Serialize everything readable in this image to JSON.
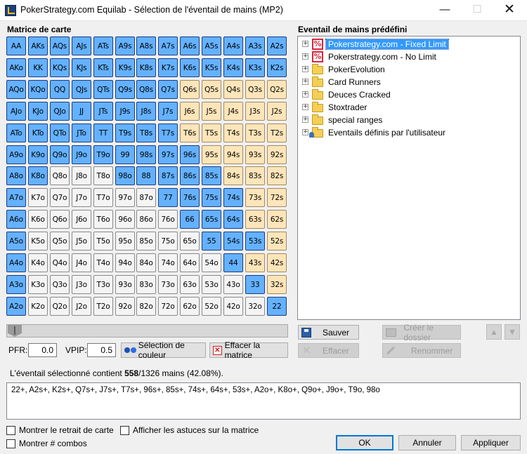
{
  "window": {
    "title": "PokerStrategy.com Equilab - Sélection de l'éventail de mains (MP2)",
    "min_glyph": "—",
    "max_glyph": "☐",
    "close_glyph": "✕"
  },
  "matrix": {
    "label": "Matrice de carte",
    "rows": [
      [
        [
          "AA",
          "s"
        ],
        [
          "AKs",
          "s"
        ],
        [
          "AQs",
          "s"
        ],
        [
          "AJs",
          "s"
        ],
        [
          "ATs",
          "s"
        ],
        [
          "A9s",
          "s"
        ],
        [
          "A8s",
          "s"
        ],
        [
          "A7s",
          "s"
        ],
        [
          "A6s",
          "s"
        ],
        [
          "A5s",
          "s"
        ],
        [
          "A4s",
          "s"
        ],
        [
          "A3s",
          "s"
        ],
        [
          "A2s",
          "s"
        ]
      ],
      [
        [
          "AKo",
          "s"
        ],
        [
          "KK",
          "s"
        ],
        [
          "KQs",
          "s"
        ],
        [
          "KJs",
          "s"
        ],
        [
          "KTs",
          "s"
        ],
        [
          "K9s",
          "s"
        ],
        [
          "K8s",
          "s"
        ],
        [
          "K7s",
          "s"
        ],
        [
          "K6s",
          "s"
        ],
        [
          "K5s",
          "s"
        ],
        [
          "K4s",
          "s"
        ],
        [
          "K3s",
          "s"
        ],
        [
          "K2s",
          "s"
        ]
      ],
      [
        [
          "AQo",
          "s"
        ],
        [
          "KQo",
          "s"
        ],
        [
          "QQ",
          "s"
        ],
        [
          "QJs",
          "s"
        ],
        [
          "QTs",
          "s"
        ],
        [
          "Q9s",
          "s"
        ],
        [
          "Q8s",
          "s"
        ],
        [
          "Q7s",
          "s"
        ],
        [
          "Q6s",
          "u"
        ],
        [
          "Q5s",
          "u"
        ],
        [
          "Q4s",
          "u"
        ],
        [
          "Q3s",
          "u"
        ],
        [
          "Q2s",
          "u"
        ]
      ],
      [
        [
          "AJo",
          "s"
        ],
        [
          "KJo",
          "s"
        ],
        [
          "QJo",
          "s"
        ],
        [
          "JJ",
          "s"
        ],
        [
          "JTs",
          "s"
        ],
        [
          "J9s",
          "s"
        ],
        [
          "J8s",
          "s"
        ],
        [
          "J7s",
          "s"
        ],
        [
          "J6s",
          "u"
        ],
        [
          "J5s",
          "u"
        ],
        [
          "J4s",
          "u"
        ],
        [
          "J3s",
          "u"
        ],
        [
          "J2s",
          "u"
        ]
      ],
      [
        [
          "ATo",
          "s"
        ],
        [
          "KTo",
          "s"
        ],
        [
          "QTo",
          "s"
        ],
        [
          "JTo",
          "s"
        ],
        [
          "TT",
          "s"
        ],
        [
          "T9s",
          "s"
        ],
        [
          "T8s",
          "s"
        ],
        [
          "T7s",
          "s"
        ],
        [
          "T6s",
          "u"
        ],
        [
          "T5s",
          "u"
        ],
        [
          "T4s",
          "u"
        ],
        [
          "T3s",
          "u"
        ],
        [
          "T2s",
          "u"
        ]
      ],
      [
        [
          "A9o",
          "s"
        ],
        [
          "K9o",
          "s"
        ],
        [
          "Q9o",
          "s"
        ],
        [
          "J9o",
          "s"
        ],
        [
          "T9o",
          "s"
        ],
        [
          "99",
          "s"
        ],
        [
          "98s",
          "s"
        ],
        [
          "97s",
          "s"
        ],
        [
          "96s",
          "s"
        ],
        [
          "95s",
          "u"
        ],
        [
          "94s",
          "u"
        ],
        [
          "93s",
          "u"
        ],
        [
          "92s",
          "u"
        ]
      ],
      [
        [
          "A8o",
          "s"
        ],
        [
          "K8o",
          "s"
        ],
        [
          "Q8o",
          "o"
        ],
        [
          "J8o",
          "o"
        ],
        [
          "T8o",
          "o"
        ],
        [
          "98o",
          "s"
        ],
        [
          "88",
          "s"
        ],
        [
          "87s",
          "s"
        ],
        [
          "86s",
          "s"
        ],
        [
          "85s",
          "s"
        ],
        [
          "84s",
          "u"
        ],
        [
          "83s",
          "u"
        ],
        [
          "82s",
          "u"
        ]
      ],
      [
        [
          "A7o",
          "s"
        ],
        [
          "K7o",
          "o"
        ],
        [
          "Q7o",
          "o"
        ],
        [
          "J7o",
          "o"
        ],
        [
          "T7o",
          "o"
        ],
        [
          "97o",
          "o"
        ],
        [
          "87o",
          "o"
        ],
        [
          "77",
          "s"
        ],
        [
          "76s",
          "s"
        ],
        [
          "75s",
          "s"
        ],
        [
          "74s",
          "s"
        ],
        [
          "73s",
          "u"
        ],
        [
          "72s",
          "u"
        ]
      ],
      [
        [
          "A6o",
          "s"
        ],
        [
          "K6o",
          "o"
        ],
        [
          "Q6o",
          "o"
        ],
        [
          "J6o",
          "o"
        ],
        [
          "T6o",
          "o"
        ],
        [
          "96o",
          "o"
        ],
        [
          "86o",
          "o"
        ],
        [
          "76o",
          "o"
        ],
        [
          "66",
          "s"
        ],
        [
          "65s",
          "s"
        ],
        [
          "64s",
          "s"
        ],
        [
          "63s",
          "u"
        ],
        [
          "62s",
          "u"
        ]
      ],
      [
        [
          "A5o",
          "s"
        ],
        [
          "K5o",
          "o"
        ],
        [
          "Q5o",
          "o"
        ],
        [
          "J5o",
          "o"
        ],
        [
          "T5o",
          "o"
        ],
        [
          "95o",
          "o"
        ],
        [
          "85o",
          "o"
        ],
        [
          "75o",
          "o"
        ],
        [
          "65o",
          "o"
        ],
        [
          "55",
          "s"
        ],
        [
          "54s",
          "s"
        ],
        [
          "53s",
          "s"
        ],
        [
          "52s",
          "u"
        ]
      ],
      [
        [
          "A4o",
          "s"
        ],
        [
          "K4o",
          "o"
        ],
        [
          "Q4o",
          "o"
        ],
        [
          "J4o",
          "o"
        ],
        [
          "T4o",
          "o"
        ],
        [
          "94o",
          "o"
        ],
        [
          "84o",
          "o"
        ],
        [
          "74o",
          "o"
        ],
        [
          "64o",
          "o"
        ],
        [
          "54o",
          "o"
        ],
        [
          "44",
          "s"
        ],
        [
          "43s",
          "u"
        ],
        [
          "42s",
          "u"
        ]
      ],
      [
        [
          "A3o",
          "s"
        ],
        [
          "K3o",
          "o"
        ],
        [
          "Q3o",
          "o"
        ],
        [
          "J3o",
          "o"
        ],
        [
          "T3o",
          "o"
        ],
        [
          "93o",
          "o"
        ],
        [
          "83o",
          "o"
        ],
        [
          "73o",
          "o"
        ],
        [
          "63o",
          "o"
        ],
        [
          "53o",
          "o"
        ],
        [
          "43o",
          "o"
        ],
        [
          "33",
          "s"
        ],
        [
          "32s",
          "u"
        ]
      ],
      [
        [
          "A2o",
          "s"
        ],
        [
          "K2o",
          "o"
        ],
        [
          "Q2o",
          "o"
        ],
        [
          "J2o",
          "o"
        ],
        [
          "T2o",
          "o"
        ],
        [
          "92o",
          "o"
        ],
        [
          "82o",
          "o"
        ],
        [
          "72o",
          "o"
        ],
        [
          "62o",
          "o"
        ],
        [
          "52o",
          "o"
        ],
        [
          "42o",
          "o"
        ],
        [
          "32o",
          "o"
        ],
        [
          "22",
          "s"
        ]
      ]
    ]
  },
  "controls": {
    "pfr_label": "PFR:",
    "pfr_value": "0.0",
    "vpip_label": "VPIP:",
    "vpip_value": "0.5",
    "color_button": "Sélection de couleur",
    "clear_button": "Effacer la matrice"
  },
  "predefined": {
    "label": "Eventail de mains prédéfini",
    "items": [
      {
        "label": "Pokerstrategy.com - Fixed Limit",
        "icon": "pokerstrategy-icon"
      },
      {
        "label": "Pokerstrategy.com - No Limit",
        "icon": "pokerstrategy-icon"
      },
      {
        "label": "PokerEvolution",
        "icon": "folder-icon"
      },
      {
        "label": "Card Runners",
        "icon": "folder-icon"
      },
      {
        "label": "Deuces Cracked",
        "icon": "folder-icon"
      },
      {
        "label": "Stoxtrader",
        "icon": "folder-icon"
      },
      {
        "label": "special ranges",
        "icon": "folder-icon"
      },
      {
        "label": "Eventails définis par l'utilisateur",
        "icon": "user-folder-icon"
      }
    ],
    "expander_glyph": "+",
    "save": "Sauver",
    "delete": "Effacer",
    "create_folder": "Créer le dossier",
    "rename": "Renommer",
    "up_glyph": "▲",
    "down_glyph": "▼"
  },
  "summary": {
    "prefix": "L'éventail sélectionné contient ",
    "count": "558",
    "suffix": "/1326 mains (42.08%)."
  },
  "range_text": "22+, A2s+, K2s+, Q7s+, J7s+, T7s+, 96s+, 85s+, 74s+, 64s+, 53s+, A2o+, K8o+, Q9o+, J9o+, T9o, 98o",
  "options": {
    "card_removal": "Montrer le retrait de carte",
    "matrix_tips": "Afficher les astuces sur la matrice",
    "show_combos": "Montrer # combos"
  },
  "buttons": {
    "ok": "OK",
    "cancel": "Annuler",
    "apply": "Appliquer"
  },
  "colors": {
    "selected": "#64b1ff",
    "suited_unselected": "#fde5b9",
    "offsuit_unselected": "#f4f4f4"
  }
}
